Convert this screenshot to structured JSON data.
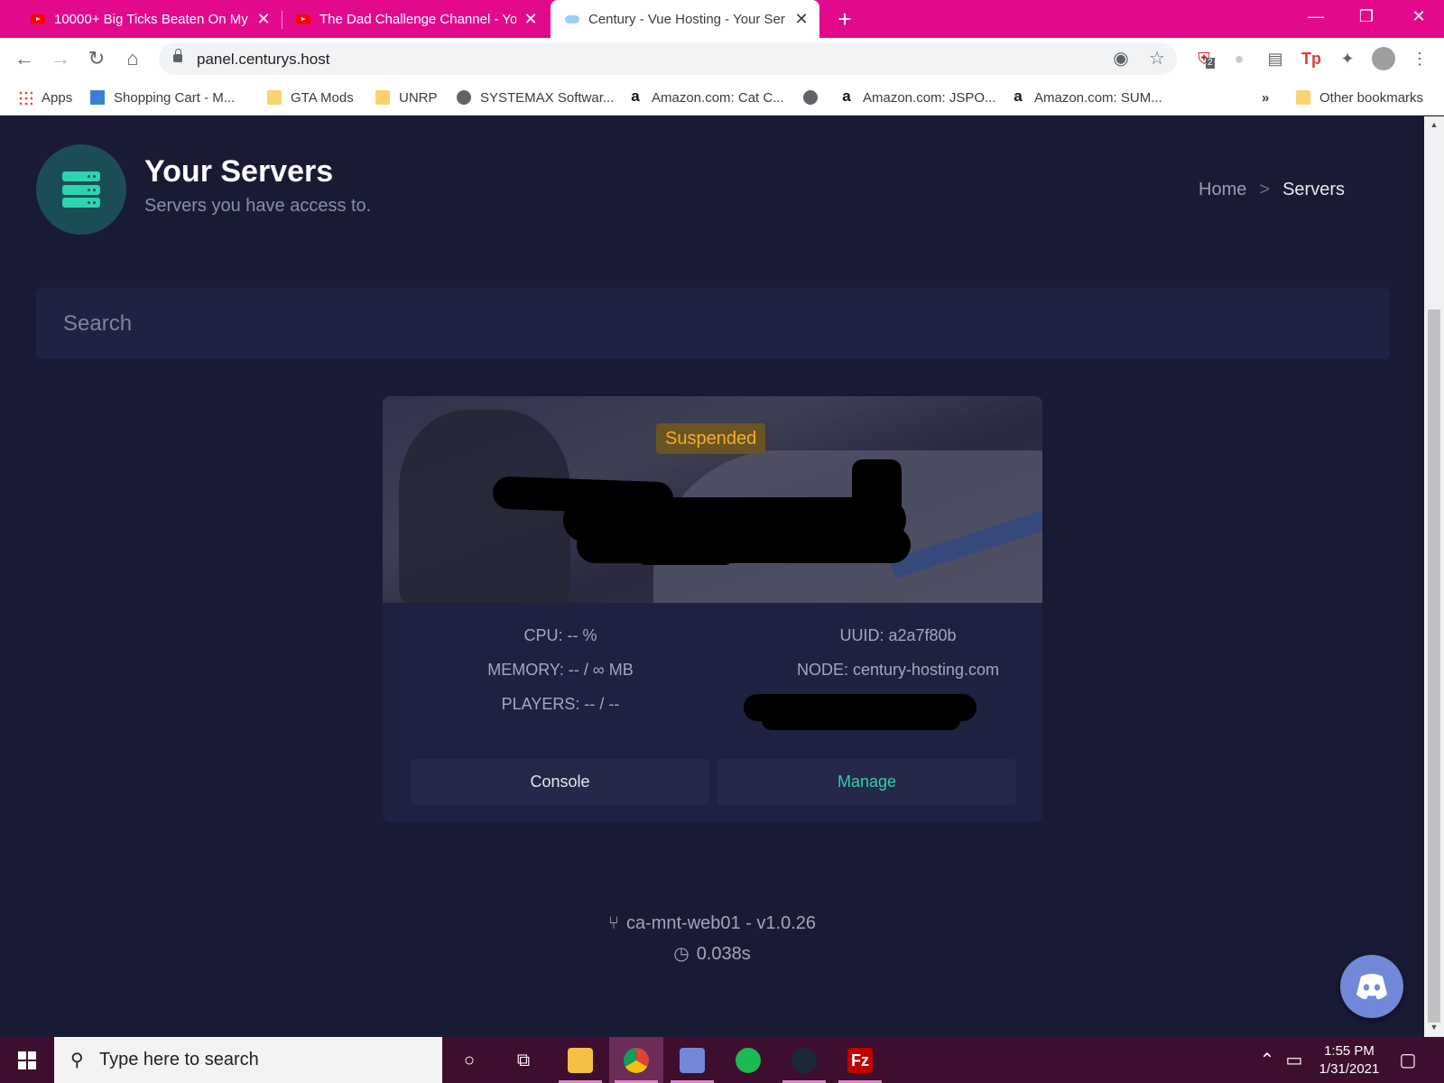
{
  "browser": {
    "tabs": [
      {
        "title": "10000+ Big Ticks Beaten On My F",
        "icon": "youtube-icon"
      },
      {
        "title": "The Dad Challenge Channel - You",
        "icon": "youtube-icon"
      },
      {
        "title": "Century - Vue Hosting - Your Ser",
        "icon": "cloud-icon",
        "active": true
      }
    ],
    "url": "panel.centurys.host",
    "bookmarks": [
      {
        "label": "Apps",
        "icon": "apps-grid-icon"
      },
      {
        "label": "Shopping Cart - M...",
        "icon": "cart-icon"
      },
      {
        "label": "GTA Mods",
        "icon": "folder-icon"
      },
      {
        "label": "UNRP",
        "icon": "folder-icon"
      },
      {
        "label": "SYSTEMAX Softwar...",
        "icon": "globe-icon"
      },
      {
        "label": "Amazon.com: Cat C...",
        "icon": "amazon-icon"
      },
      {
        "label": "",
        "icon": "globe-icon"
      },
      {
        "label": "Amazon.com: JSPO...",
        "icon": "amazon-icon"
      },
      {
        "label": "Amazon.com: SUM...",
        "icon": "amazon-icon"
      }
    ],
    "bookmarks_overflow": "»",
    "other_bookmarks": "Other bookmarks",
    "extension_badge": "2"
  },
  "page": {
    "title": "Your Servers",
    "subtitle": "Servers you have access to.",
    "breadcrumb": {
      "home": "Home",
      "separator": ">",
      "current": "Servers"
    },
    "search": {
      "placeholder": "Search"
    }
  },
  "server": {
    "status": "Suspended",
    "cpu": "CPU: -- %",
    "memory": "MEMORY: -- / ∞ MB",
    "players": "PLAYERS: -- / --",
    "uuid": "UUID: a2a7f80b",
    "node": "NODE: century-hosting.com",
    "console_label": "Console",
    "manage_label": "Manage"
  },
  "footer": {
    "version": "ca-mnt-web01 - v1.0.26",
    "timing": "0.038s"
  },
  "taskbar": {
    "search_placeholder": "Type here to search",
    "time": "1:55 PM",
    "date": "1/31/2021"
  },
  "colors": {
    "tab_strip": "#e20a8b",
    "page_bg": "#191a34",
    "accent_teal": "#2fcfaa",
    "status_amber": "#f2b02c",
    "discord": "#7289da",
    "taskbar": "#3e0e2e"
  }
}
